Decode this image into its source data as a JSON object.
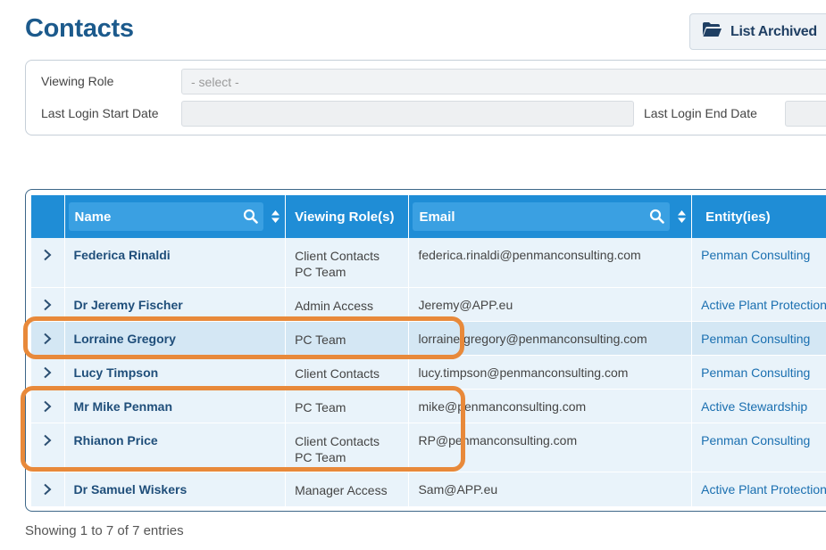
{
  "page": {
    "title": "Contacts",
    "list_archived_label": "List Archived",
    "showing_text": "Showing 1 to 7 of 7 entries"
  },
  "filters": {
    "viewing_role_label": "Viewing Role",
    "viewing_role_value": "- select -",
    "last_login_start_label": "Last Login Start Date",
    "last_login_end_label": "Last Login End Date"
  },
  "table": {
    "columns": [
      "Name",
      "Viewing Role(s)",
      "Email",
      "Entity(ies)"
    ],
    "rows": [
      {
        "name": "Federica Rinaldi",
        "roles": [
          "Client Contacts",
          "PC Team"
        ],
        "email": "federica.rinaldi@penmanconsulting.com",
        "entity": "Penman Consulting"
      },
      {
        "name": "Dr Jeremy Fischer",
        "roles": [
          "Admin Access"
        ],
        "email": "Jeremy@APP.eu",
        "entity": "Active Plant Protection"
      },
      {
        "name": "Lorraine Gregory",
        "roles": [
          "PC Team"
        ],
        "email": "lorraine.gregory@penmanconsulting.com",
        "entity": "Penman Consulting"
      },
      {
        "name": "Lucy Timpson",
        "roles": [
          "Client Contacts"
        ],
        "email": "lucy.timpson@penmanconsulting.com",
        "entity": "Penman Consulting"
      },
      {
        "name": "Mr Mike Penman",
        "roles": [
          "PC Team"
        ],
        "email": "mike@penmanconsulting.com",
        "entity": "Active Stewardship"
      },
      {
        "name": "Rhianon Price",
        "roles": [
          "Client Contacts",
          "PC Team"
        ],
        "email": "RP@penmanconsulting.com",
        "entity": "Penman Consulting"
      },
      {
        "name": "Dr Samuel Wiskers",
        "roles": [
          "Manager Access"
        ],
        "email": "Sam@APP.eu",
        "entity": "Active Plant Protection"
      }
    ]
  },
  "colors": {
    "title": "#1c5a8c",
    "header_bg": "#1f8dd6",
    "row_bg": "#e9f3fa",
    "row_highlight": "#d4e7f4",
    "annotation": "#e8893a"
  },
  "icons": {
    "archive": "folder-open-icon",
    "search": "search-icon",
    "sort": "sort-icon",
    "expand": "chevron-right-icon"
  }
}
